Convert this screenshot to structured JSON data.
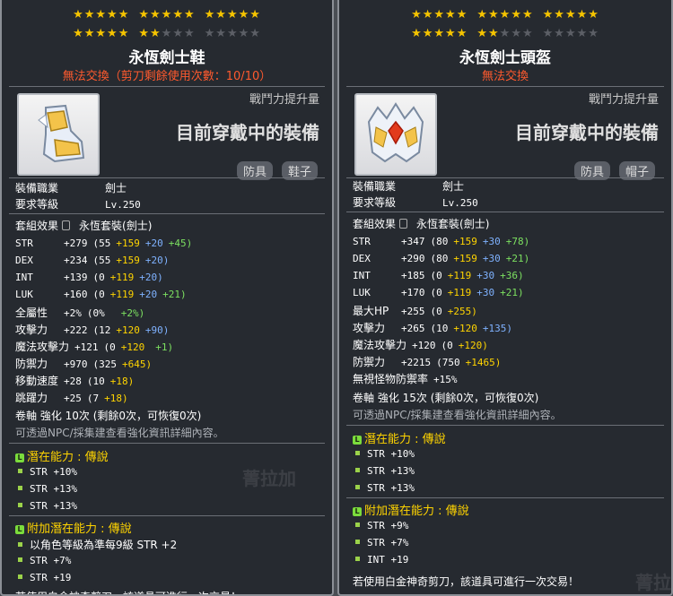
{
  "left": {
    "star_rows": [
      [
        "★★★★★",
        "★★★★★",
        "★★★★★"
      ],
      [
        "★★★★★",
        "★★",
        ""
      ]
    ],
    "star_off_row2": [
      "",
      "★★★",
      "★★★★★"
    ],
    "title": "永恆劍士鞋",
    "trade_note": "無法交換（剪刀剩餘使用次數：10/10）",
    "power": "戰鬥力提升量",
    "equipped": "目前穿戴中的裝備",
    "tag1": "防具",
    "tag2": "鞋子",
    "job_label": "裝備職業",
    "job_value": "劍士",
    "level_label": "要求等級",
    "level_value": "Lv.250",
    "set_label": "套組效果",
    "set_value": "永恆套裝(劍士)",
    "stats": [
      {
        "name": "STR",
        "total": "+279",
        "base": "(55",
        "a": "+159",
        "b": "+20",
        "c": "+45)"
      },
      {
        "name": "DEX",
        "total": "+234",
        "base": "(55",
        "a": "+159",
        "b": "+20)",
        "c": ""
      },
      {
        "name": "INT",
        "total": "+139",
        "base": "(0",
        "a": "+119",
        "b": "+20)",
        "c": ""
      },
      {
        "name": "LUK",
        "total": "+160",
        "base": "(0",
        "a": "+119",
        "b": "+20",
        "c": "+21)"
      },
      {
        "name": "全屬性",
        "total": "+2%",
        "base": "(0%",
        "a": "",
        "b": "",
        "c": "+2%)"
      },
      {
        "name": "攻擊力",
        "total": "+222",
        "base": "(12",
        "a": "+120",
        "b": "+90)",
        "c": ""
      },
      {
        "name": "魔法攻擊力",
        "total": "+121",
        "base": "(0",
        "a": "+120",
        "b": "",
        "c": "+1)"
      },
      {
        "name": "防禦力",
        "total": "+970",
        "base": "(325",
        "a": "+645)",
        "b": "",
        "c": ""
      },
      {
        "name": "移動速度",
        "total": "+28",
        "base": "(10",
        "a": "+18)",
        "b": "",
        "c": ""
      },
      {
        "name": "跳躍力",
        "total": "+25",
        "base": "(7",
        "a": "+18)",
        "b": "",
        "c": ""
      }
    ],
    "scroll_line": "卷軸 強化 10次 (剩餘0次，可恢復0次)",
    "npc_note": "可透過NPC/採集建查看強化資訊詳細內容。",
    "potential_head": "潛在能力 : 傳說",
    "potential": [
      "STR +10%",
      "STR +13%",
      "STR +13%"
    ],
    "add_potential_head": "附加潛在能力 : 傳說",
    "add_potential": [
      "以角色等級為準每9級 STR +2",
      "STR +7%",
      "STR +19"
    ],
    "bottom_note": "若使用白金神奇剪刀，該道具可進行一次交易！"
  },
  "right": {
    "title": "永恆劍士頭盔",
    "trade_note": "無法交換",
    "power": "戰鬥力提升量",
    "equipped": "目前穿戴中的裝備",
    "tag1": "防具",
    "tag2": "帽子",
    "job_label": "裝備職業",
    "job_value": "劍士",
    "level_label": "要求等級",
    "level_value": "Lv.250",
    "set_label": "套組效果",
    "set_value": "永恆套裝(劍士)",
    "stats": [
      {
        "name": "STR",
        "total": "+347",
        "base": "(80",
        "a": "+159",
        "b": "+30",
        "c": "+78)"
      },
      {
        "name": "DEX",
        "total": "+290",
        "base": "(80",
        "a": "+159",
        "b": "+30",
        "c": "+21)"
      },
      {
        "name": "INT",
        "total": "+185",
        "base": "(0",
        "a": "+119",
        "b": "+30",
        "c": "+36)"
      },
      {
        "name": "LUK",
        "total": "+170",
        "base": "(0",
        "a": "+119",
        "b": "+30",
        "c": "+21)"
      },
      {
        "name": "最大HP",
        "total": "+255",
        "base": "(0",
        "a": "+255)",
        "b": "",
        "c": ""
      },
      {
        "name": "攻擊力",
        "total": "+265",
        "base": "(10",
        "a": "+120",
        "b": "+135)",
        "c": ""
      },
      {
        "name": "魔法攻擊力",
        "total": "+120",
        "base": "(0",
        "a": "+120)",
        "b": "",
        "c": ""
      },
      {
        "name": "防禦力",
        "total": "+2215",
        "base": "(750",
        "a": "+1465)",
        "b": "",
        "c": ""
      },
      {
        "name": "無視怪物防禦率",
        "total": "+15%",
        "base": "",
        "a": "",
        "b": "",
        "c": ""
      }
    ],
    "scroll_line": "卷軸 強化 15次 (剩餘0次，可恢復0次)",
    "npc_note": "可透過NPC/採集建查看強化資訊詳細內容。",
    "potential_head": "潛在能力 : 傳說",
    "potential": [
      "STR +10%",
      "STR +13%",
      "STR +13%"
    ],
    "add_potential_head": "附加潛在能力 : 傳說",
    "add_potential": [
      "STR +9%",
      "STR +7%",
      "INT +19"
    ],
    "bottom_note": "若使用白金神奇剪刀，該道具可進行一次交易！"
  },
  "background": {
    "ghost1": "菁拉加",
    "ghost2": "菁拉"
  }
}
